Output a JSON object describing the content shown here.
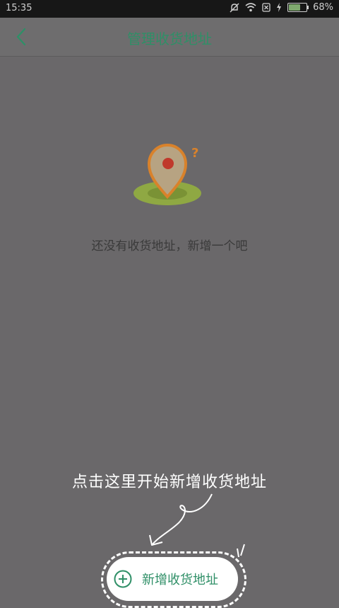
{
  "status_bar": {
    "time": "15:35",
    "battery": "68%",
    "battery_level": 0.68,
    "icons": [
      "mute-icon",
      "wifi-icon",
      "sim-error-icon",
      "charging-icon"
    ]
  },
  "header": {
    "title": "管理收货地址",
    "back_icon": "chevron-left-icon"
  },
  "empty_state": {
    "message": "还没有收货地址，新增一个吧",
    "illustration": "map-pin-question-icon"
  },
  "guide": {
    "hint": "点击这里开始新增收货地址"
  },
  "add_button": {
    "label": "新增收货地址",
    "icon": "plus-circle-icon"
  },
  "colors": {
    "accent": "#2f8f67",
    "overlay": "#6a686a",
    "pin_orange": "#d9822b",
    "pin_red": "#c0392b",
    "ground_green": "#8fa843"
  }
}
